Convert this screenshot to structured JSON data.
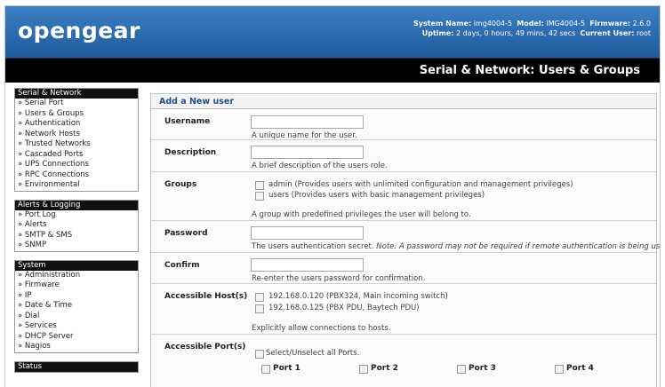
{
  "header": {
    "logo": "opengear",
    "system_name_label": "System Name:",
    "system_name": "img4004-5",
    "model_label": "Model:",
    "model": "IMG4004-5",
    "firmware_label": "Firmware:",
    "firmware": "2.6.0",
    "uptime_label": "Uptime:",
    "uptime": "2 days, 0 hours, 49 mins, 42 secs",
    "user_label": "Current User:",
    "user": "root"
  },
  "page_title": "Serial & Network: Users & Groups",
  "sidebar": {
    "serial": {
      "title": "Serial & Network",
      "items": [
        "» Serial Port",
        "» Users & Groups",
        "» Authentication",
        "» Network Hosts",
        "» Trusted Networks",
        "» Cascaded Ports",
        "» UPS Connections",
        "» RPC Connections",
        "» Environmental"
      ]
    },
    "alerts": {
      "title": "Alerts & Logging",
      "items": [
        "» Port Log",
        "» Alerts",
        "» SMTP & SMS",
        "» SNMP"
      ]
    },
    "system": {
      "title": "System",
      "items": [
        "» Administration",
        "» Firmware",
        "» IP",
        "» Date & Time",
        "» Dial",
        "» Services",
        "» DHCP Server",
        "» Nagios"
      ]
    },
    "status": {
      "title": "Status"
    }
  },
  "form": {
    "heading": "Add a New user",
    "username": {
      "label": "Username",
      "value": "",
      "help": "A unique name for the user."
    },
    "description": {
      "label": "Description",
      "value": "",
      "help": "A brief description of the users role."
    },
    "groups": {
      "label": "Groups",
      "options": [
        {
          "text": "admin (Provides users with unlimited configuration and management privileges)",
          "checked": false
        },
        {
          "text": "users (Provides users with basic management privileges)",
          "checked": false
        }
      ],
      "help": "A group with predefined privileges the user will belong to."
    },
    "password": {
      "label": "Password",
      "value": "",
      "help": "The users authentication secret.",
      "note": "Note: A password may not be required if remote authentication is being used."
    },
    "confirm": {
      "label": "Confirm",
      "value": "",
      "help": "Re-enter the users password for confirmation."
    },
    "hosts": {
      "label": "Accessible Host(s)",
      "options": [
        {
          "text": "192.168.0.120 (PBX324, Main incoming switch)",
          "checked": false
        },
        {
          "text": "192.168.0.125 (PBX PDU, Baytech PDU)",
          "checked": false
        }
      ],
      "help": "Explicitly allow connections to hosts."
    },
    "ports": {
      "label": "Accessible Port(s)",
      "select_all": "Select/Unselect all Ports.",
      "items": [
        "Port 1",
        "Port 2",
        "Port 3",
        "Port 4"
      ]
    }
  }
}
